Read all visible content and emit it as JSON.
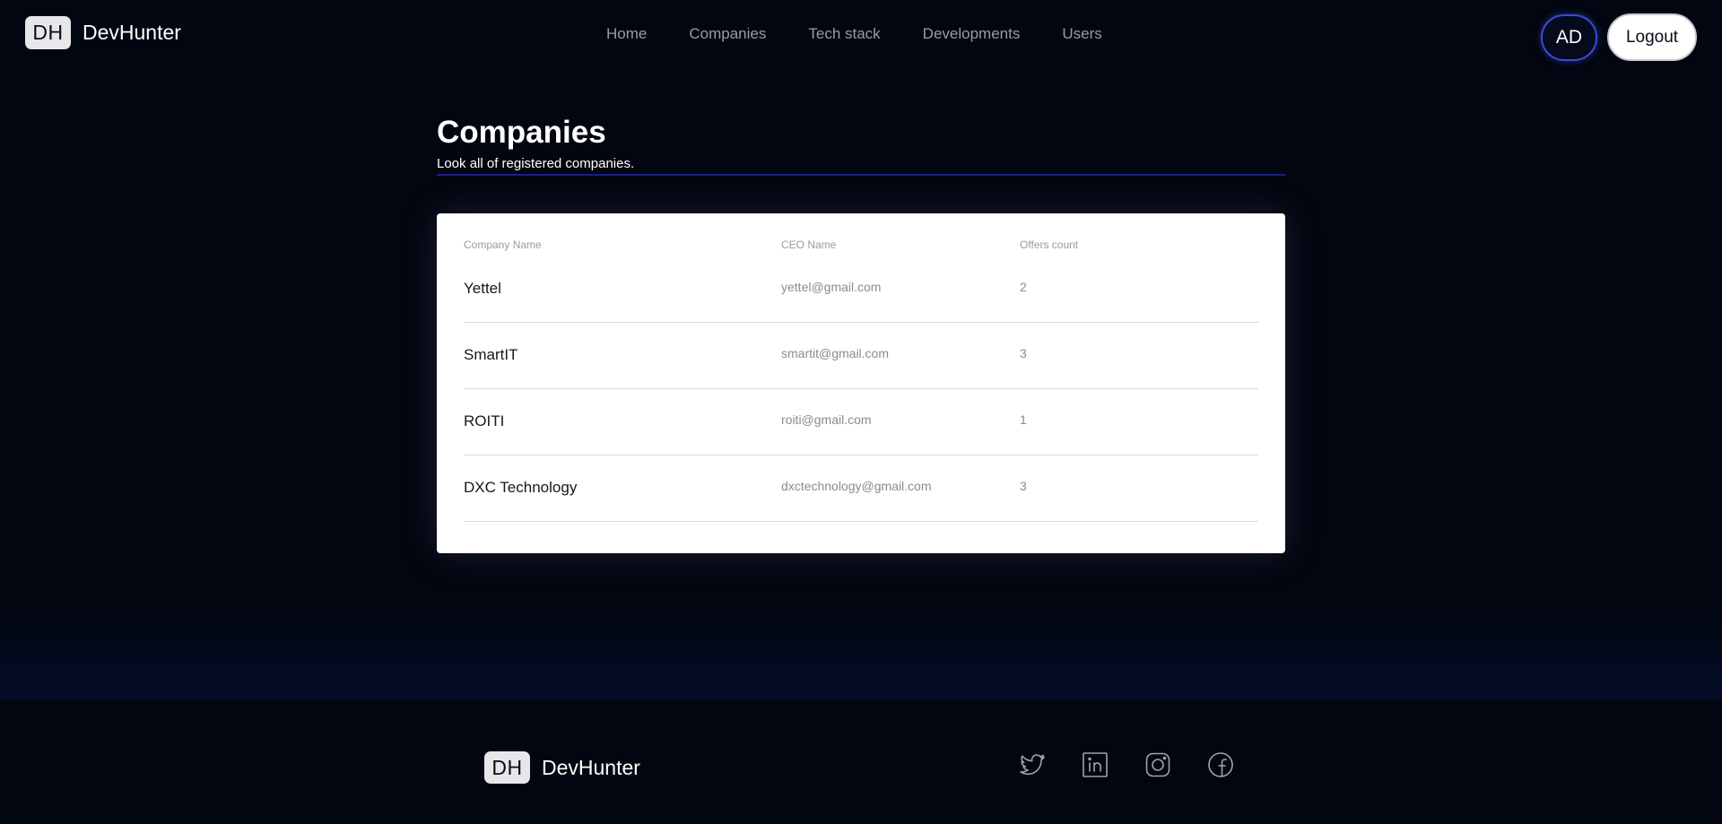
{
  "brand": {
    "badge": "DH",
    "name": "DevHunter"
  },
  "nav": {
    "items": [
      {
        "label": "Home"
      },
      {
        "label": "Companies"
      },
      {
        "label": "Tech stack"
      },
      {
        "label": "Developments"
      },
      {
        "label": "Users"
      }
    ]
  },
  "header": {
    "avatar_initials": "AD",
    "logout_label": "Logout"
  },
  "page": {
    "title": "Companies",
    "subtitle": "Look all of registered companies."
  },
  "table": {
    "columns": [
      "Company Name",
      "CEO Name",
      "Offers count"
    ],
    "rows": [
      {
        "name": "Yettel",
        "ceo": "yettel@gmail.com",
        "offers": "2"
      },
      {
        "name": "SmartIT",
        "ceo": "smartit@gmail.com",
        "offers": "3"
      },
      {
        "name": "ROITI",
        "ceo": "roiti@gmail.com",
        "offers": "1"
      },
      {
        "name": "DXC Technology",
        "ceo": "dxctechnology@gmail.com",
        "offers": "3"
      }
    ]
  },
  "footer": {
    "brand": {
      "badge": "DH",
      "name": "DevHunter"
    },
    "social_icons": [
      "twitter-icon",
      "linkedin-icon",
      "instagram-icon",
      "facebook-icon"
    ]
  },
  "colors": {
    "background": "#020610",
    "accent": "#3b4ad6",
    "title_rule": "#1a1d8a",
    "card": "#ffffff"
  }
}
